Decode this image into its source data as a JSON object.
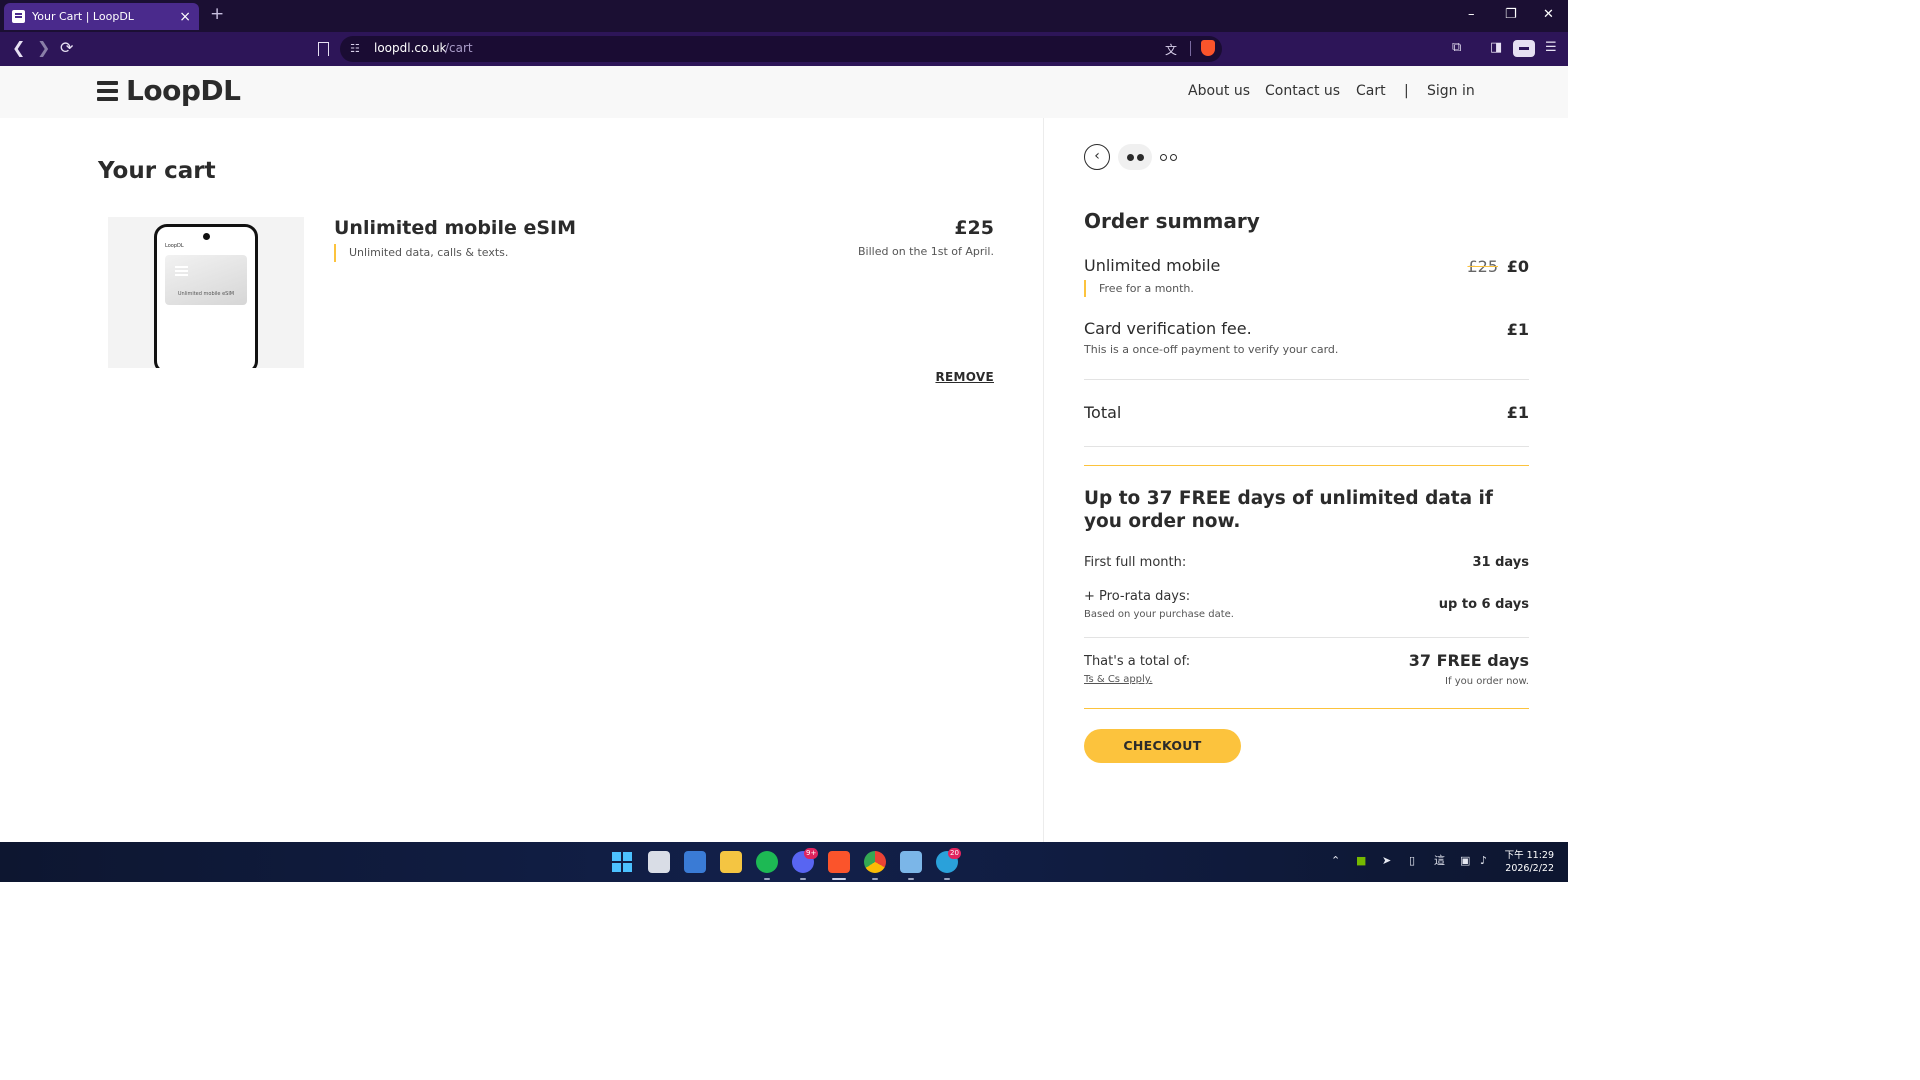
{
  "browser": {
    "tab_title": "Your Cart | LoopDL",
    "tab_close": "×",
    "new_tab": "+",
    "url_host": "loopdl.co.uk",
    "url_path": "/cart",
    "window_controls": {
      "minimize": "–",
      "restore": "❐",
      "close": "✕"
    }
  },
  "header": {
    "logo": "LoopDL",
    "nav": {
      "about": "About us",
      "contact": "Contact us",
      "cart": "Cart",
      "separator": "|",
      "sign_in": "Sign in"
    }
  },
  "cart": {
    "title": "Your cart",
    "item": {
      "name": "Unlimited mobile eSIM",
      "description": "Unlimited data, calls & texts.",
      "price": "£25",
      "billing": "Billed on the 1st of April.",
      "remove": "REMOVE",
      "image_card_label": "Unlimited mobile eSIM",
      "image_brand": "LoopDL"
    }
  },
  "checkout_steps": {
    "total": 3,
    "current": 1
  },
  "order_summary": {
    "title": "Order summary",
    "lines": [
      {
        "label": "Unlimited mobile",
        "note": "Free for a month.",
        "original_price": "£25",
        "price": "£0"
      },
      {
        "label": "Card verification fee.",
        "note": "This is a once-off payment to verify your card.",
        "price": "£1"
      }
    ],
    "total_label": "Total",
    "total_value": "£1"
  },
  "promo": {
    "title": "Up to 37 FREE days of unlimited data if you order now.",
    "first_month_label": "First full month:",
    "first_month_value": "31 days",
    "prorata_label": "+ Pro-rata days:",
    "prorata_note": "Based on your purchase date.",
    "prorata_value": "up to 6 days",
    "total_label": "That's a total of:",
    "tc_link": "Ts & Cs apply.",
    "total_value": "37 FREE days",
    "total_note": "If you order now.",
    "checkout": "CHECKOUT"
  },
  "taskbar": {
    "clock_time": "下午 11:29",
    "clock_date": "2026/2/22",
    "badges": {
      "discord": "9+",
      "telegram": "20"
    }
  },
  "colors": {
    "accent": "#fcc33d",
    "browser_tab": "#4a2a8c",
    "browser_toolbar": "#2d1558",
    "text": "#2b2b2b"
  }
}
